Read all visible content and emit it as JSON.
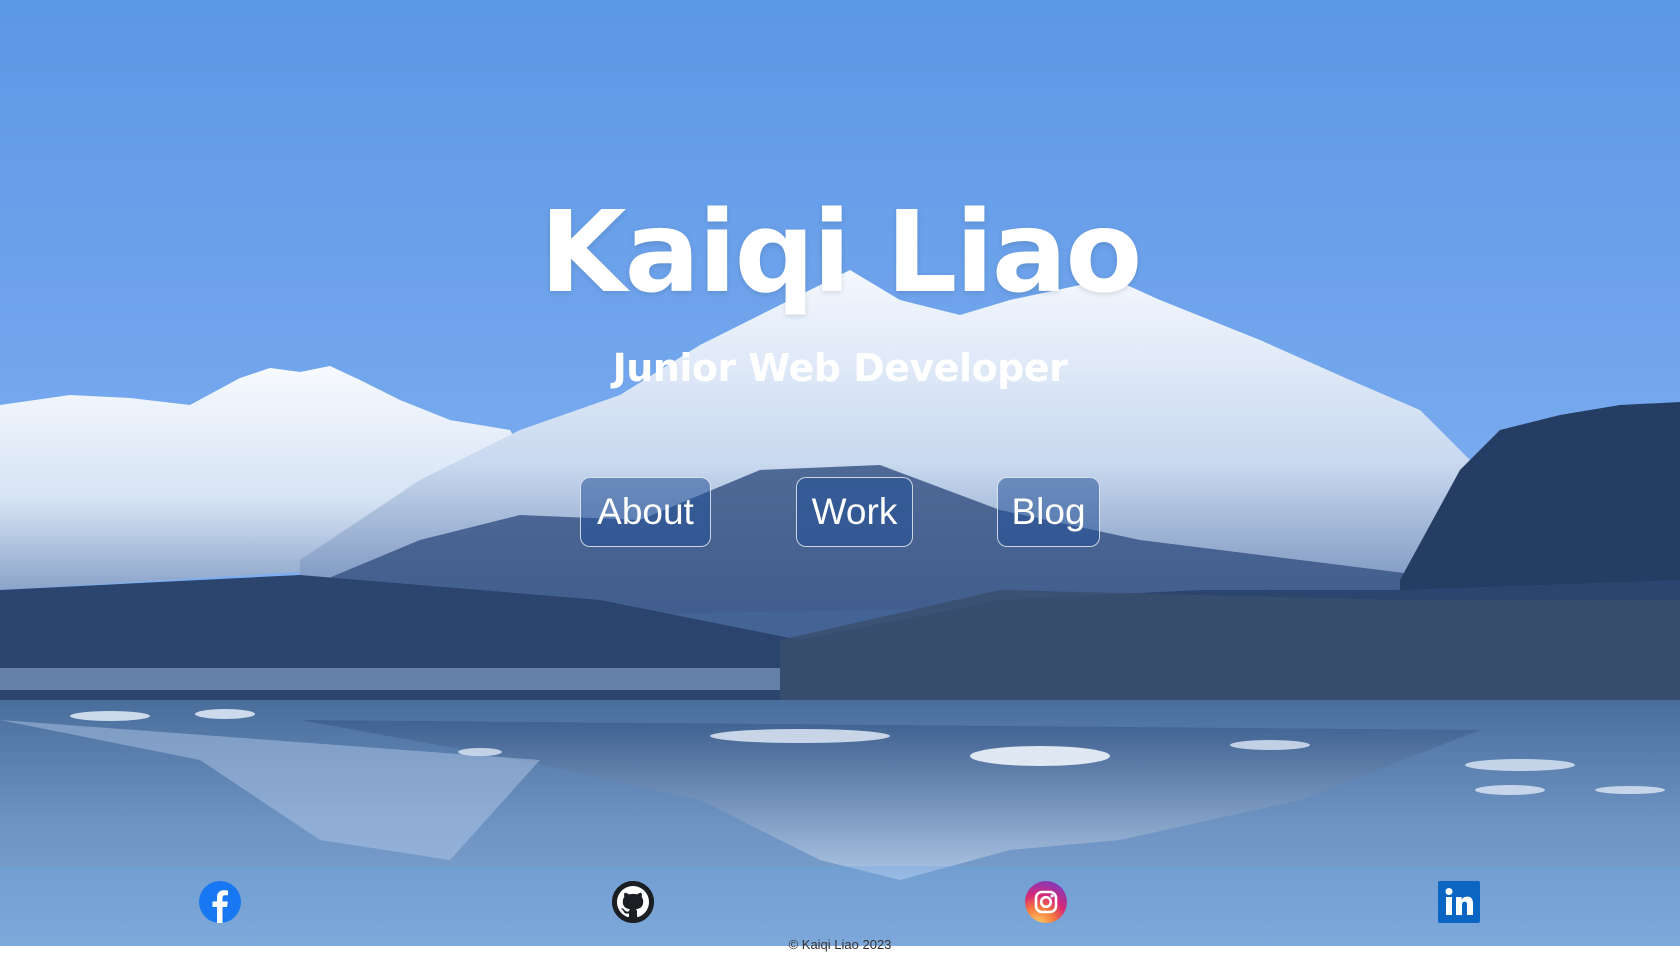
{
  "hero": {
    "title": "Kaiqi Liao",
    "subtitle": "Junior Web Developer"
  },
  "nav": {
    "about_label": "About",
    "work_label": "Work",
    "blog_label": "Blog"
  },
  "footer": {
    "social_icons": [
      "facebook-icon",
      "github-icon",
      "instagram-icon",
      "linkedin-icon"
    ],
    "copyright": "© Kaiqi Liao 2023"
  },
  "colors": {
    "sky_top": "#5f9ae8",
    "sky_horizon": "#9cc3f5",
    "facebook": "#1877f2",
    "github": "#1b1f23",
    "linkedin": "#0a66c2"
  }
}
